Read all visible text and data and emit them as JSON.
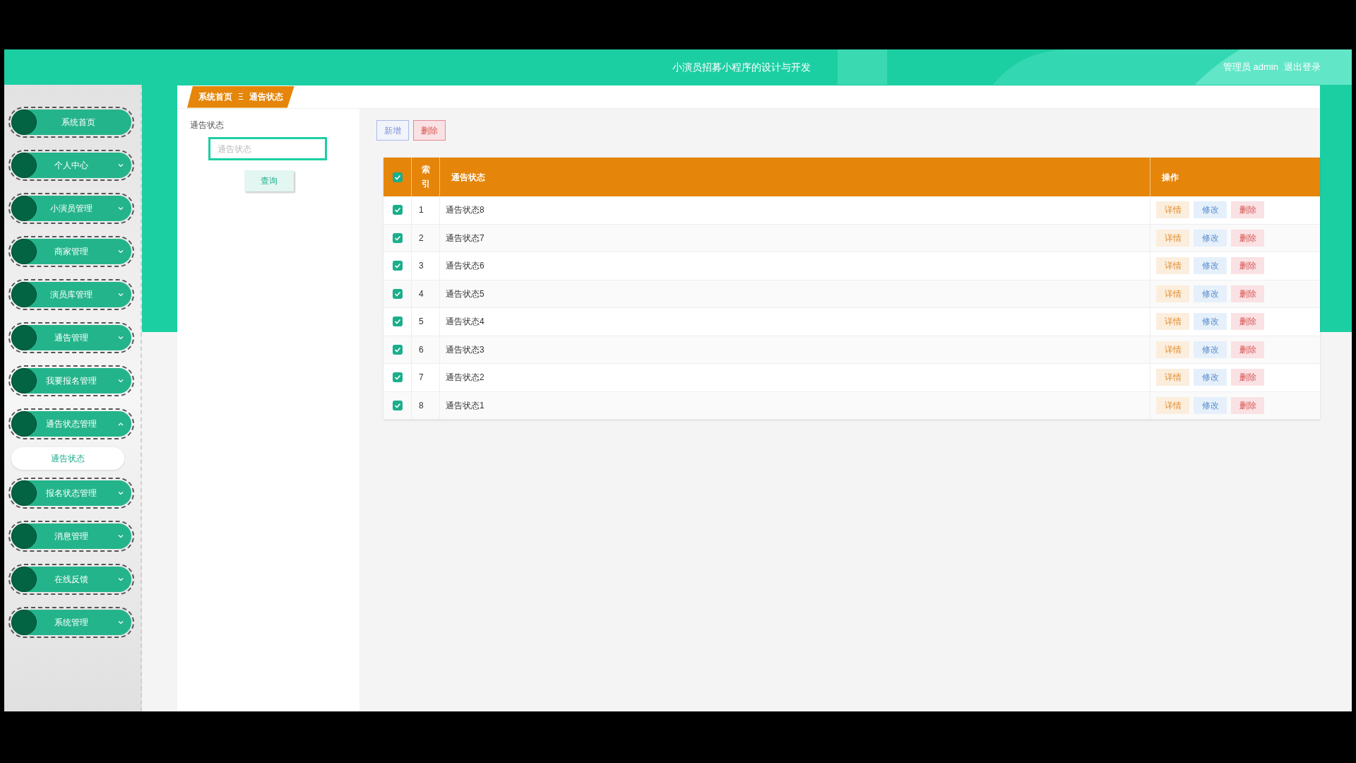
{
  "header": {
    "title": "小演员招募小程序的设计与开发",
    "user": "管理员 admin",
    "logout": "退出登录"
  },
  "sidebar": {
    "items": [
      {
        "label": "系统首页",
        "kind": "link"
      },
      {
        "label": "个人中心",
        "kind": "menu",
        "expanded": false
      },
      {
        "label": "小演员管理",
        "kind": "menu",
        "expanded": false
      },
      {
        "label": "商家管理",
        "kind": "menu",
        "expanded": false
      },
      {
        "label": "演员库管理",
        "kind": "menu",
        "expanded": false
      },
      {
        "label": "通告管理",
        "kind": "menu",
        "expanded": false
      },
      {
        "label": "我要报名管理",
        "kind": "menu",
        "expanded": false
      },
      {
        "label": "通告状态管理",
        "kind": "menu",
        "expanded": true,
        "children": [
          {
            "label": "通告状态"
          }
        ]
      },
      {
        "label": "报名状态管理",
        "kind": "menu",
        "expanded": false
      },
      {
        "label": "消息管理",
        "kind": "menu",
        "expanded": false
      },
      {
        "label": "在线反馈",
        "kind": "menu",
        "expanded": false
      },
      {
        "label": "系统管理",
        "kind": "menu",
        "expanded": false
      }
    ]
  },
  "breadcrumb": {
    "home": "系统首页",
    "separator": "Ξ",
    "current": "通告状态"
  },
  "filter": {
    "label": "通告状态",
    "placeholder": "通告状态",
    "button": "查询"
  },
  "toolbar": {
    "add": "新增",
    "delete": "删除"
  },
  "table": {
    "all_checked": true,
    "columns": [
      "索引",
      "通告状态",
      "操作"
    ],
    "rows": [
      {
        "checked": true,
        "index": "1",
        "status": "通告状态8",
        "actions": [
          "详情",
          "修改",
          "删除"
        ]
      },
      {
        "checked": true,
        "index": "2",
        "status": "通告状态7",
        "actions": [
          "详情",
          "修改",
          "删除"
        ]
      },
      {
        "checked": true,
        "index": "3",
        "status": "通告状态6",
        "actions": [
          "详情",
          "修改",
          "删除"
        ]
      },
      {
        "checked": true,
        "index": "4",
        "status": "通告状态5",
        "actions": [
          "详情",
          "修改",
          "删除"
        ]
      },
      {
        "checked": true,
        "index": "5",
        "status": "通告状态4",
        "actions": [
          "详情",
          "修改",
          "删除"
        ]
      },
      {
        "checked": true,
        "index": "6",
        "status": "通告状态3",
        "actions": [
          "详情",
          "修改",
          "删除"
        ]
      },
      {
        "checked": true,
        "index": "7",
        "status": "通告状态2",
        "actions": [
          "详情",
          "修改",
          "删除"
        ]
      },
      {
        "checked": true,
        "index": "8",
        "status": "通告状态1",
        "actions": [
          "详情",
          "修改",
          "删除"
        ]
      }
    ]
  }
}
